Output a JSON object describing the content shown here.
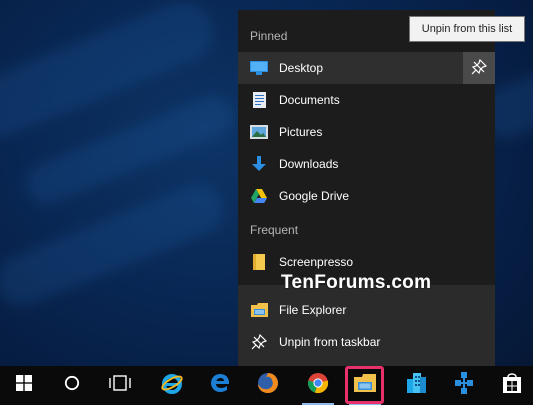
{
  "jumplist": {
    "pinned_header": "Pinned",
    "pinned_items": [
      {
        "label": "Desktop",
        "icon": "desktop-icon"
      },
      {
        "label": "Documents",
        "icon": "documents-icon"
      },
      {
        "label": "Pictures",
        "icon": "pictures-icon"
      },
      {
        "label": "Downloads",
        "icon": "downloads-icon"
      },
      {
        "label": "Google Drive",
        "icon": "google-drive-icon"
      }
    ],
    "frequent_header": "Frequent",
    "frequent_items": [
      {
        "label": "Screenpresso",
        "icon": "folder-icon"
      }
    ],
    "tasks": [
      {
        "label": "File Explorer",
        "icon": "file-explorer-icon"
      },
      {
        "label": "Unpin from taskbar",
        "icon": "unpin-icon"
      }
    ]
  },
  "tooltip": {
    "text": "Unpin from this list"
  },
  "watermark": {
    "text": "TenForums.com"
  },
  "taskbar": {
    "items": [
      "windows-start-icon",
      "cortana-icon",
      "task-view-icon",
      "internet-explorer-icon",
      "edge-icon",
      "firefox-icon",
      "chrome-icon",
      "file-explorer-icon",
      "office-icon",
      "network-icon",
      "store-icon"
    ],
    "highlight_color": "#e8306a"
  }
}
